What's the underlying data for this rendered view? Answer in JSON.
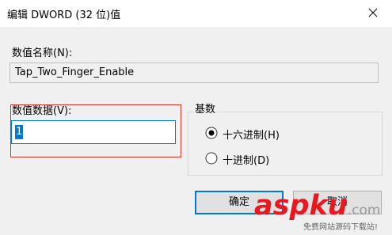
{
  "window": {
    "title": "编辑 DWORD (32 位)值",
    "close_icon": "close-icon"
  },
  "value_name": {
    "label": "数值名称(N):",
    "value": "Tap_Two_Finger_Enable"
  },
  "value_data": {
    "label": "数值数据(V):",
    "value": "1"
  },
  "base": {
    "label": "基数",
    "options": [
      {
        "label": "十六进制(H)",
        "selected": true
      },
      {
        "label": "十进制(D)",
        "selected": false
      }
    ]
  },
  "buttons": {
    "ok": "确定",
    "cancel": "取消"
  },
  "watermark": {
    "logo": "aspku",
    "tld": ".com",
    "tagline": "免费网站源码下载站!"
  },
  "colors": {
    "accent": "#0078d7",
    "highlight_border": "#d9302c",
    "dialog_bg": "#f0f0f0",
    "logo_red": "#e8181e"
  }
}
